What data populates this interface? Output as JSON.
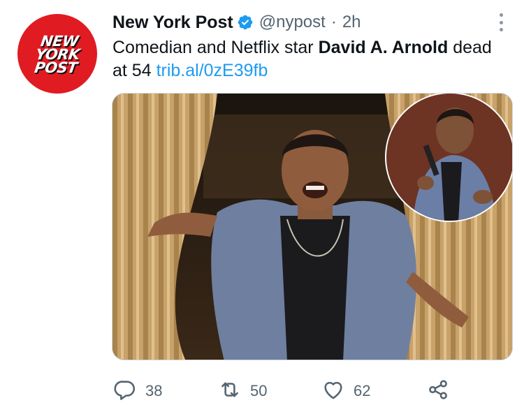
{
  "account": {
    "avatar_logo_lines": [
      "NEW",
      "YORK",
      "POST"
    ],
    "name": "New York Post",
    "handle": "@nypost",
    "separator": "·",
    "time": "2h"
  },
  "tweet": {
    "text_before": "Comedian and Netflix star ",
    "text_bold": "David A. Arnold",
    "text_after": " dead at 54 ",
    "link": "trib.al/0zE39fb"
  },
  "media": {
    "icon": "photo",
    "inset_icon": "photo-inset-circle"
  },
  "actions": {
    "reply": {
      "icon": "reply-icon",
      "count": "38"
    },
    "retweet": {
      "icon": "retweet-icon",
      "count": "50"
    },
    "like": {
      "icon": "heart-icon",
      "count": "62"
    },
    "share": {
      "icon": "share-icon"
    }
  },
  "colors": {
    "brand_red": "#e11b22",
    "verified_blue": "#1d9bf0",
    "link_blue": "#1d9bf0",
    "secondary_text": "#536471"
  }
}
